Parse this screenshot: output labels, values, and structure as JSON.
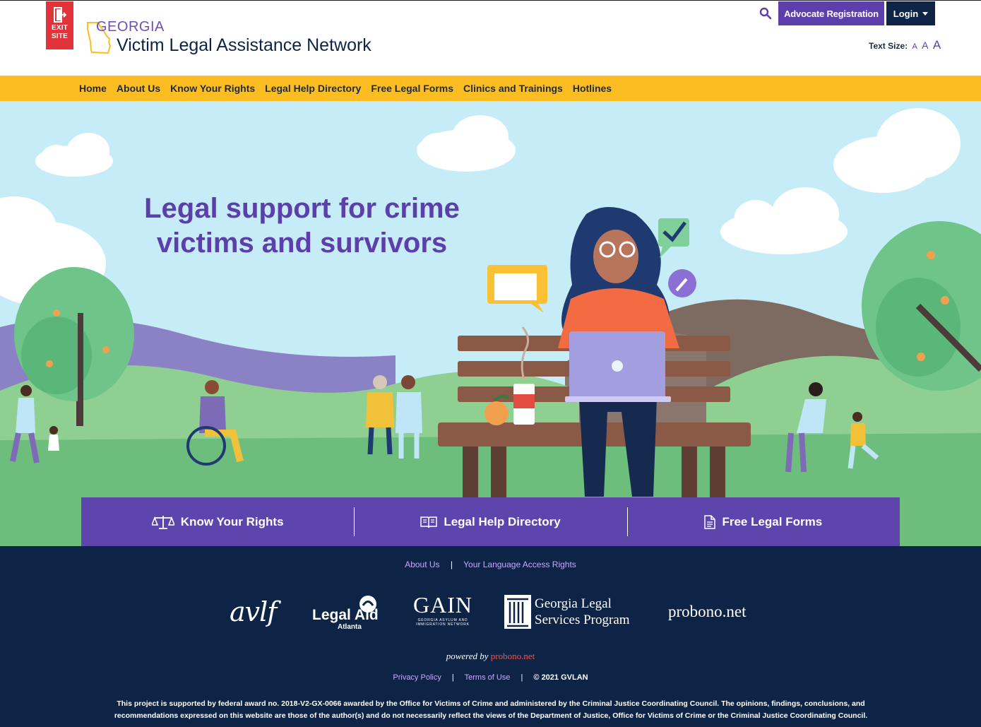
{
  "header": {
    "exit_site": {
      "line1": "EXIT",
      "line2": "SITE"
    },
    "brand_small": "GEORGIA",
    "brand_big": "Victim Legal Assistance Network",
    "advocate_registration": "Advocate Registration",
    "login": "Login",
    "text_size_label": "Text Size:",
    "text_size_options": [
      "A",
      "A",
      "A"
    ]
  },
  "nav": {
    "items": [
      {
        "label": "Home"
      },
      {
        "label": "About Us"
      },
      {
        "label": "Know Your Rights"
      },
      {
        "label": "Legal Help Directory"
      },
      {
        "label": "Free Legal Forms"
      },
      {
        "label": "Clinics and Trainings"
      },
      {
        "label": "Hotlines"
      }
    ]
  },
  "hero": {
    "title_line1": "Legal support for crime",
    "title_line2": "victims and survivors"
  },
  "quick_links": [
    {
      "label": "Know Your Rights",
      "icon": "scales-icon"
    },
    {
      "label": "Legal Help Directory",
      "icon": "book-icon"
    },
    {
      "label": "Free Legal Forms",
      "icon": "document-icon"
    }
  ],
  "footer": {
    "links": [
      "About Us",
      "Your Language Access Rights"
    ],
    "partners": {
      "avlf": "avlf",
      "legal_aid_line1": "Legal Aid",
      "legal_aid_line2": "Atlanta",
      "gain": "GAIN",
      "gain_sub1": "GEORGIA ASYLUM AND",
      "gain_sub2": "IMMIGRATION NETWORK",
      "glsp_line1": "Georgia Legal",
      "glsp_line2": "Services Program",
      "probono": "probono.net"
    },
    "powered_by": "powered by",
    "powered_by_brand": "probono.net",
    "bottom_links": [
      "Privacy Policy",
      "Terms of Use"
    ],
    "copyright": "© 2021 GVLAN",
    "disclaimer": "This project is supported by federal award no. 2018-V2-GX-0066 awarded by the Office for Victims of Crime and administered by the Criminal Justice Coordinating Council. The opinions, findings, conclusions, and recommendations expressed on this website are those of the author(s) and do not necessarily reflect the views of the Department of Justice, Office for Victims of Crime or the Criminal Justice Coordinating Council."
  },
  "colors": {
    "brand_purple": "#5d3fab",
    "navy": "#0e2447",
    "nav_yellow": "#fbbd22",
    "exit_red": "#e0343a",
    "sky": "#c6ecf8"
  }
}
